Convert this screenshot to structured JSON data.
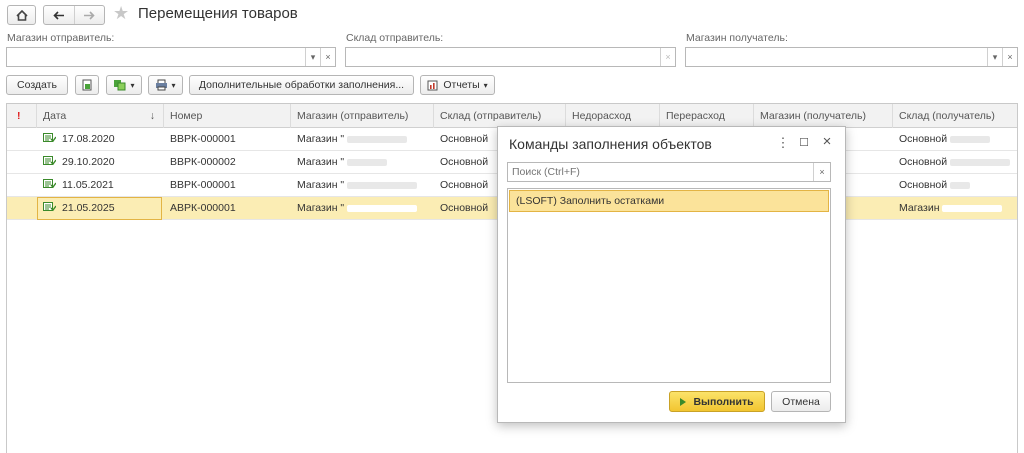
{
  "window": {
    "title": "Перемещения товаров"
  },
  "filters": {
    "sender_store_label": "Магазин отправитель:",
    "sender_warehouse_label": "Склад отправитель:",
    "receiver_store_label": "Магазин получатель:"
  },
  "toolbar": {
    "create_label": "Создать",
    "fill_processing_label": "Дополнительные обработки заполнения...",
    "reports_label": "Отчеты"
  },
  "table": {
    "columns": {
      "flag": "!",
      "date": "Дата",
      "sort": "↓",
      "number": "Номер",
      "store_sender": "Магазин (отправитель)",
      "warehouse_sender": "Склад (отправитель)",
      "shortage": "Недорасход",
      "overage": "Перерасход",
      "store_receiver": "Магазин (получатель)",
      "warehouse_receiver": "Склад (получатель)"
    },
    "rows": [
      {
        "date": "17.08.2020",
        "number": "ВВРК-000001",
        "store_sender": "Магазин \"",
        "warehouse_sender": "Основной",
        "store_receiver": "",
        "warehouse_receiver": "Основной"
      },
      {
        "date": "29.10.2020",
        "number": "ВВРК-000002",
        "store_sender": "Магазин \"",
        "warehouse_sender": "Основной",
        "store_receiver": "",
        "warehouse_receiver": "Основной"
      },
      {
        "date": "11.05.2021",
        "number": "ВВРК-000001",
        "store_sender": "Магазин \"",
        "warehouse_sender": "Основной",
        "store_receiver": "",
        "warehouse_receiver": "Основной"
      },
      {
        "date": "21.05.2025",
        "number": "АВРК-000001",
        "store_sender": "Магазин \"",
        "warehouse_sender": "Основной",
        "store_receiver": "",
        "warehouse_receiver": "Магазин"
      }
    ]
  },
  "dialog": {
    "title": "Команды заполнения объектов",
    "search_placeholder": "Поиск (Ctrl+F)",
    "items": [
      "(LSOFT) Заполнить остатками"
    ],
    "run_label": "Выполнить",
    "cancel_label": "Отмена"
  },
  "colors": {
    "accent_yellow": "#f2c530",
    "selected_row": "#fbedb4",
    "doc_icon_green": "#3a8a2a"
  }
}
